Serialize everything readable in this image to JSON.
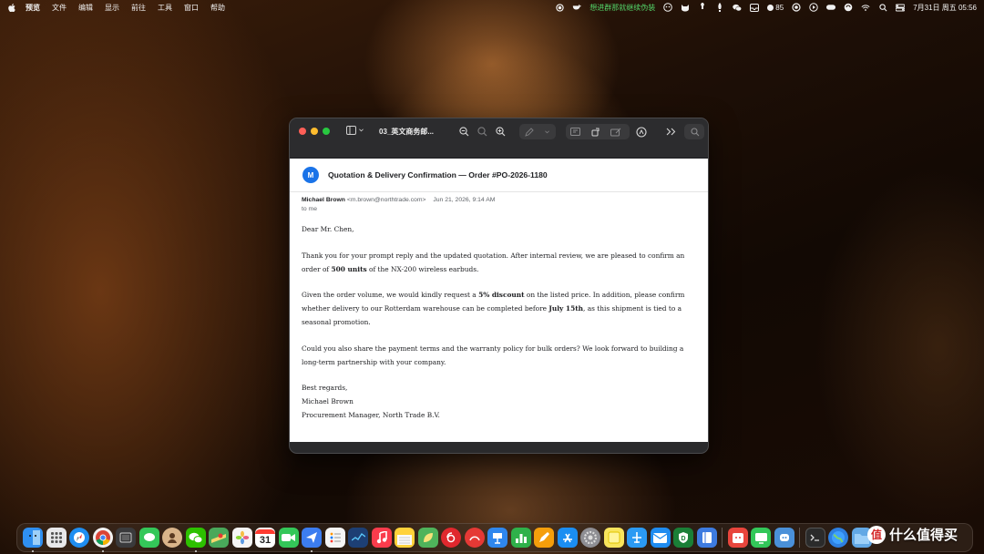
{
  "menubar": {
    "app_menus": [
      "预览",
      "文件",
      "编辑",
      "显示",
      "前往",
      "工具",
      "窗口",
      "帮助"
    ],
    "status_text": "想进群那就继续伪装",
    "battery_count": "85",
    "datetime": "7月31日 周五  05:56"
  },
  "window": {
    "title": "03_英文商务邮..."
  },
  "email": {
    "avatar_letter": "M",
    "subject": "Quotation & Delivery Confirmation — Order #PO-2026-1180",
    "sender_name": "Michael Brown",
    "sender_email": "<m.brown@northtrade.com>",
    "date": "Jun 21, 2026, 9:14 AM",
    "recipient": "to me",
    "greeting": "Dear Mr. Chen,",
    "p1_a": "Thank you for your prompt reply and the updated quotation. After internal review, we are pleased to confirm an order of ",
    "p1_bold": "500 units",
    "p1_b": " of the NX-200 wireless earbuds.",
    "p2_a": "Given the order volume, we would kindly request a ",
    "p2_bold1": "5% discount",
    "p2_b": " on the listed price. In addition, please confirm whether delivery to our Rotterdam warehouse can be completed before ",
    "p2_bold2": "July 15th",
    "p2_c": ", as this shipment is tied to a seasonal promotion.",
    "p3": "Could you also share the payment terms and the warranty policy for bulk orders? We look forward to building a long-term partnership with your company.",
    "closing": "Best regards,",
    "signature_name": "Michael Brown",
    "signature_title": "Procurement Manager, North Trade B.V."
  },
  "dock": {
    "calendar_day": "31",
    "apps": [
      {
        "name": "finder",
        "color": "#2f8ff0"
      },
      {
        "name": "launchpad",
        "color": "#e8e8ea"
      },
      {
        "name": "safari",
        "color": "#1f8ef1"
      },
      {
        "name": "chrome",
        "color": "#f2f2f2"
      },
      {
        "name": "ipad-mirror",
        "color": "#3a3a3c"
      },
      {
        "name": "messages",
        "color": "#34c759"
      },
      {
        "name": "contacts",
        "color": "#d9b48a"
      },
      {
        "name": "wechat",
        "color": "#2dc100"
      },
      {
        "name": "maps",
        "color": "#49a85a"
      },
      {
        "name": "photos",
        "color": "#f5f5f5"
      },
      {
        "name": "calendar",
        "color": "#ffffff"
      },
      {
        "name": "facetime",
        "color": "#34c759"
      },
      {
        "name": "migration",
        "color": "#3c7df0"
      },
      {
        "name": "reminders",
        "color": "#f5f5f5"
      },
      {
        "name": "stocks",
        "color": "#1d3f74"
      },
      {
        "name": "music",
        "color": "#fa3c4c"
      },
      {
        "name": "notes",
        "color": "#ffd23a"
      },
      {
        "name": "reader",
        "color": "#4fb35b"
      },
      {
        "name": "netease",
        "color": "#e0282e"
      },
      {
        "name": "mindnode",
        "color": "#e53935"
      },
      {
        "name": "keynote",
        "color": "#2f87ee"
      },
      {
        "name": "numbers",
        "color": "#2fb14a"
      },
      {
        "name": "pages",
        "color": "#f59e0b"
      },
      {
        "name": "app-store",
        "color": "#1b8ef2"
      },
      {
        "name": "system-preferences",
        "color": "#8e8e93"
      },
      {
        "name": "sticky",
        "color": "#f8e45c"
      },
      {
        "name": "testflight",
        "color": "#2b9af3"
      },
      {
        "name": "airmail",
        "color": "#1f8cf0"
      },
      {
        "name": "guard",
        "color": "#1a7f37"
      },
      {
        "name": "dictionary",
        "color": "#3d7be0"
      },
      {
        "name": "pomodoro",
        "color": "#e8453c"
      },
      {
        "name": "screens",
        "color": "#33c759"
      },
      {
        "name": "vpn",
        "color": "#4a90d9"
      },
      {
        "name": "terminal",
        "color": "#2b2b2b"
      },
      {
        "name": "globe",
        "color": "#2d7fe0"
      },
      {
        "name": "folder",
        "color": "#62a8e5"
      },
      {
        "name": "trash",
        "color": "#c9c9cc"
      }
    ]
  },
  "watermark": {
    "logo_char": "值",
    "text": "什么值得买"
  },
  "colors": {
    "close": "#ff5f57",
    "minimize": "#febc2e",
    "zoom": "#28c840",
    "avatar_blue": "#1a73e8"
  }
}
